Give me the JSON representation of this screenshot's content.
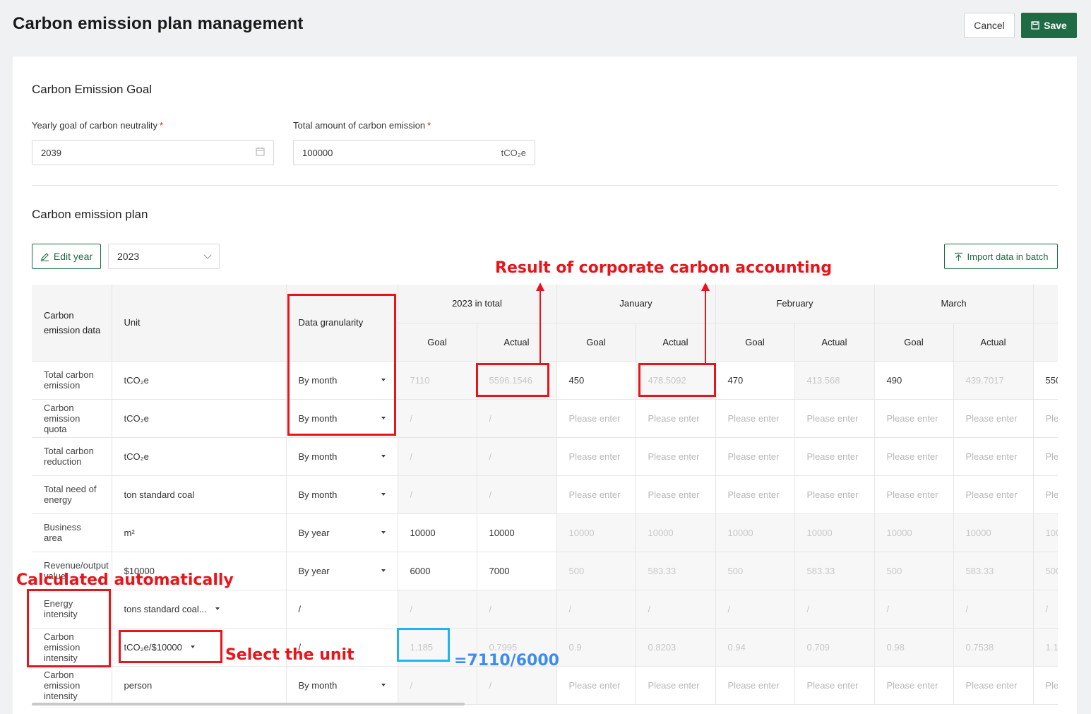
{
  "header": {
    "title": "Carbon emission plan management",
    "cancel_label": "Cancel",
    "save_label": "Save"
  },
  "goal": {
    "section_title": "Carbon Emission Goal",
    "year_label": "Yearly goal of carbon neutrality",
    "year_value": "2039",
    "total_label": "Total amount of carbon emission",
    "total_value": "100000",
    "total_unit": "tCO₂e",
    "required_mark": "*"
  },
  "plan": {
    "section_title": "Carbon emission plan",
    "edit_year_label": "Edit year",
    "year_selected": "2023",
    "import_label": "Import data in batch"
  },
  "table": {
    "headers": {
      "data": "Carbon emission data",
      "unit": "Unit",
      "granularity": "Data granularity",
      "total": "2023 in total",
      "months": [
        "January",
        "February",
        "March"
      ],
      "goal": "Goal",
      "actual": "Actual"
    },
    "rows": [
      {
        "label": "Total carbon emission",
        "unit": "tCO₂e",
        "gran": "By month",
        "cells": [
          "7110",
          "5596.1546",
          "450",
          "478.5092",
          "470",
          "413.568",
          "490",
          "439.7017",
          "550"
        ]
      },
      {
        "label": "Carbon emission quota",
        "unit": "tCO₂e",
        "gran": "By month",
        "cells": [
          "/",
          "/",
          "Please enter",
          "Please enter",
          "Please enter",
          "Please enter",
          "Please enter",
          "Please enter",
          "Ple"
        ]
      },
      {
        "label": "Total carbon reduction",
        "unit": "tCO₂e",
        "gran": "By month",
        "cells": [
          "/",
          "/",
          "Please enter",
          "Please enter",
          "Please enter",
          "Please enter",
          "Please enter",
          "Please enter",
          "Ple"
        ]
      },
      {
        "label": "Total need of energy",
        "unit": "ton standard coal",
        "gran": "By month",
        "cells": [
          "/",
          "/",
          "Please enter",
          "Please enter",
          "Please enter",
          "Please enter",
          "Please enter",
          "Please enter",
          "Ple"
        ]
      },
      {
        "label": "Business area",
        "unit": "m²",
        "gran": "By year",
        "cells": [
          "10000",
          "10000",
          "10000",
          "10000",
          "10000",
          "10000",
          "10000",
          "10000",
          "100"
        ]
      },
      {
        "label": "Revenue/output value",
        "unit": "$10000",
        "gran": "By year",
        "cells": [
          "6000",
          "7000",
          "500",
          "583.33",
          "500",
          "583.33",
          "500",
          "583.33",
          "500"
        ]
      },
      {
        "label": "Energy intensity",
        "unit": "tons standard coal...",
        "gran": "/",
        "cells": [
          "/",
          "/",
          "/",
          "/",
          "/",
          "/",
          "/",
          "/",
          "/"
        ]
      },
      {
        "label": "Carbon emission intensity",
        "unit": "tCO₂e/$10000",
        "gran": "/",
        "cells": [
          "1.185",
          "0.7995",
          "0.9",
          "0.8203",
          "0.94",
          "0.709",
          "0.98",
          "0.7538",
          "1.1"
        ]
      },
      {
        "label": "Carbon emission intensity",
        "unit": "person",
        "gran": "By month",
        "cells": [
          "/",
          "/",
          "Please enter",
          "Please enter",
          "Please enter",
          "Please enter",
          "Please enter",
          "Please enter",
          "Ple"
        ]
      }
    ]
  },
  "annotations": {
    "result": "Result of corporate carbon accounting",
    "calculated": "Calculated automatically",
    "select_unit": "Select the unit",
    "formula": "=7110/6000"
  },
  "colors": {
    "accent": "#1e6b45",
    "annotation": "#e8141a",
    "annotation_blue": "#1eb4f0"
  }
}
